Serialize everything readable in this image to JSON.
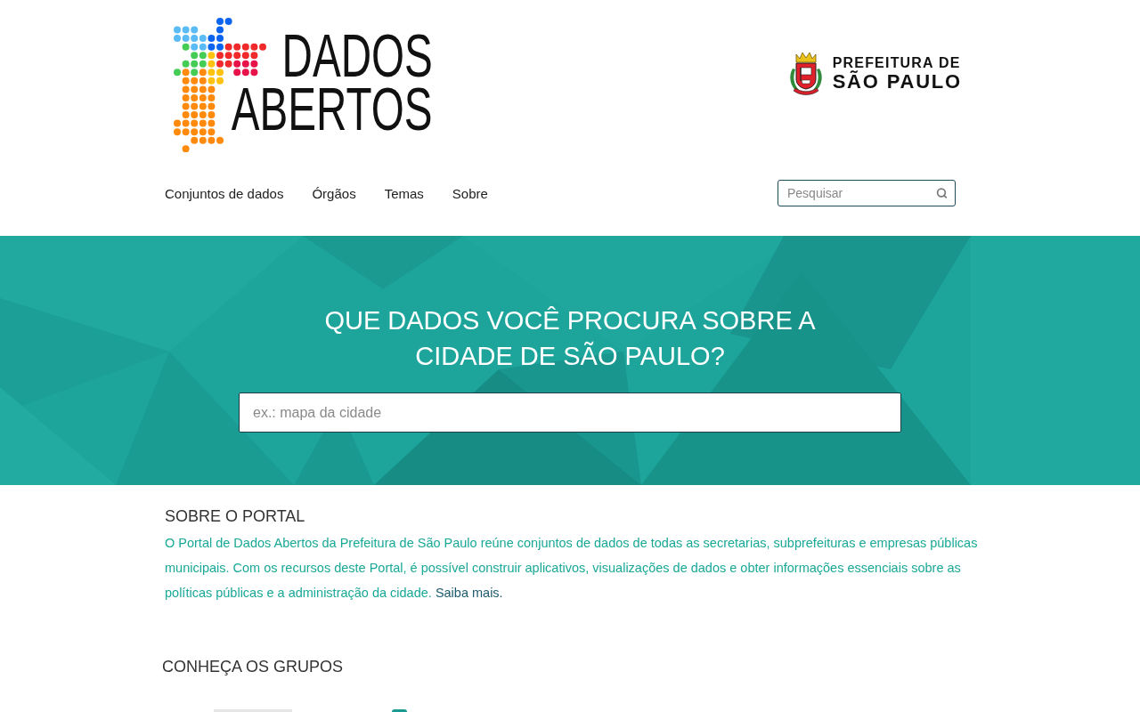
{
  "header": {
    "logo": {
      "lines": [
        "DADOS",
        "ABERTOS"
      ]
    },
    "city_logo": {
      "lines": [
        "PREFEITURA DE",
        "SÃO PAULO"
      ]
    }
  },
  "nav": {
    "items": [
      {
        "label": "Conjuntos de dados"
      },
      {
        "label": "Órgãos"
      },
      {
        "label": "Temas"
      },
      {
        "label": "Sobre"
      }
    ]
  },
  "search": {
    "placeholder": "Pesquisar"
  },
  "hero": {
    "title": "QUE DADOS VOCÊ PROCURA SOBRE A CIDADE DE SÃO PAULO?",
    "search": {
      "placeholder": "ex.: mapa da cidade"
    }
  },
  "about": {
    "title": "SOBRE O PORTAL",
    "text": "O Portal de Dados Abertos da Prefeitura de São Paulo reúne conjuntos de dados de todas as secretarias, subprefeituras e empresas públicas municipais. Com os recursos deste Portal, é possível construir aplicativos, visualizações de dados e obter informações essenciais sobre as políticas públicas e a administração da cidade.",
    "link": "Saiba mais."
  },
  "groups": {
    "title": "CONHEÇA OS GRUPOS"
  }
}
